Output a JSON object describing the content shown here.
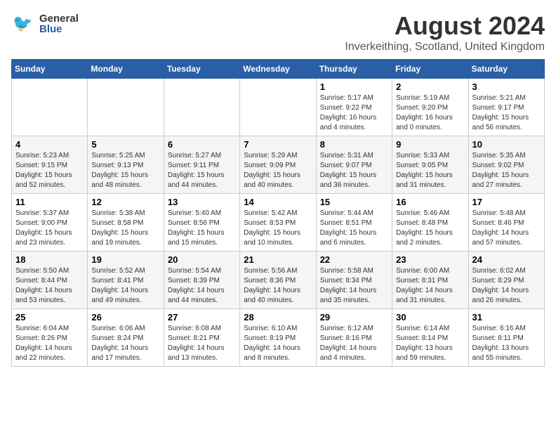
{
  "header": {
    "logo_general": "General",
    "logo_blue": "Blue",
    "month_title": "August 2024",
    "location": "Inverkeithing, Scotland, United Kingdom"
  },
  "calendar": {
    "days_of_week": [
      "Sunday",
      "Monday",
      "Tuesday",
      "Wednesday",
      "Thursday",
      "Friday",
      "Saturday"
    ],
    "weeks": [
      [
        {
          "day": "",
          "info": ""
        },
        {
          "day": "",
          "info": ""
        },
        {
          "day": "",
          "info": ""
        },
        {
          "day": "",
          "info": ""
        },
        {
          "day": "1",
          "info": "Sunrise: 5:17 AM\nSunset: 9:22 PM\nDaylight: 16 hours\nand 4 minutes."
        },
        {
          "day": "2",
          "info": "Sunrise: 5:19 AM\nSunset: 9:20 PM\nDaylight: 16 hours\nand 0 minutes."
        },
        {
          "day": "3",
          "info": "Sunrise: 5:21 AM\nSunset: 9:17 PM\nDaylight: 15 hours\nand 56 minutes."
        }
      ],
      [
        {
          "day": "4",
          "info": "Sunrise: 5:23 AM\nSunset: 9:15 PM\nDaylight: 15 hours\nand 52 minutes."
        },
        {
          "day": "5",
          "info": "Sunrise: 5:25 AM\nSunset: 9:13 PM\nDaylight: 15 hours\nand 48 minutes."
        },
        {
          "day": "6",
          "info": "Sunrise: 5:27 AM\nSunset: 9:11 PM\nDaylight: 15 hours\nand 44 minutes."
        },
        {
          "day": "7",
          "info": "Sunrise: 5:29 AM\nSunset: 9:09 PM\nDaylight: 15 hours\nand 40 minutes."
        },
        {
          "day": "8",
          "info": "Sunrise: 5:31 AM\nSunset: 9:07 PM\nDaylight: 15 hours\nand 36 minutes."
        },
        {
          "day": "9",
          "info": "Sunrise: 5:33 AM\nSunset: 9:05 PM\nDaylight: 15 hours\nand 31 minutes."
        },
        {
          "day": "10",
          "info": "Sunrise: 5:35 AM\nSunset: 9:02 PM\nDaylight: 15 hours\nand 27 minutes."
        }
      ],
      [
        {
          "day": "11",
          "info": "Sunrise: 5:37 AM\nSunset: 9:00 PM\nDaylight: 15 hours\nand 23 minutes."
        },
        {
          "day": "12",
          "info": "Sunrise: 5:38 AM\nSunset: 8:58 PM\nDaylight: 15 hours\nand 19 minutes."
        },
        {
          "day": "13",
          "info": "Sunrise: 5:40 AM\nSunset: 8:56 PM\nDaylight: 15 hours\nand 15 minutes."
        },
        {
          "day": "14",
          "info": "Sunrise: 5:42 AM\nSunset: 8:53 PM\nDaylight: 15 hours\nand 10 minutes."
        },
        {
          "day": "15",
          "info": "Sunrise: 5:44 AM\nSunset: 8:51 PM\nDaylight: 15 hours\nand 6 minutes."
        },
        {
          "day": "16",
          "info": "Sunrise: 5:46 AM\nSunset: 8:48 PM\nDaylight: 15 hours\nand 2 minutes."
        },
        {
          "day": "17",
          "info": "Sunrise: 5:48 AM\nSunset: 8:46 PM\nDaylight: 14 hours\nand 57 minutes."
        }
      ],
      [
        {
          "day": "18",
          "info": "Sunrise: 5:50 AM\nSunset: 8:44 PM\nDaylight: 14 hours\nand 53 minutes."
        },
        {
          "day": "19",
          "info": "Sunrise: 5:52 AM\nSunset: 8:41 PM\nDaylight: 14 hours\nand 49 minutes."
        },
        {
          "day": "20",
          "info": "Sunrise: 5:54 AM\nSunset: 8:39 PM\nDaylight: 14 hours\nand 44 minutes."
        },
        {
          "day": "21",
          "info": "Sunrise: 5:56 AM\nSunset: 8:36 PM\nDaylight: 14 hours\nand 40 minutes."
        },
        {
          "day": "22",
          "info": "Sunrise: 5:58 AM\nSunset: 8:34 PM\nDaylight: 14 hours\nand 35 minutes."
        },
        {
          "day": "23",
          "info": "Sunrise: 6:00 AM\nSunset: 8:31 PM\nDaylight: 14 hours\nand 31 minutes."
        },
        {
          "day": "24",
          "info": "Sunrise: 6:02 AM\nSunset: 8:29 PM\nDaylight: 14 hours\nand 26 minutes."
        }
      ],
      [
        {
          "day": "25",
          "info": "Sunrise: 6:04 AM\nSunset: 8:26 PM\nDaylight: 14 hours\nand 22 minutes."
        },
        {
          "day": "26",
          "info": "Sunrise: 6:06 AM\nSunset: 8:24 PM\nDaylight: 14 hours\nand 17 minutes."
        },
        {
          "day": "27",
          "info": "Sunrise: 6:08 AM\nSunset: 8:21 PM\nDaylight: 14 hours\nand 13 minutes."
        },
        {
          "day": "28",
          "info": "Sunrise: 6:10 AM\nSunset: 8:19 PM\nDaylight: 14 hours\nand 8 minutes."
        },
        {
          "day": "29",
          "info": "Sunrise: 6:12 AM\nSunset: 8:16 PM\nDaylight: 14 hours\nand 4 minutes."
        },
        {
          "day": "30",
          "info": "Sunrise: 6:14 AM\nSunset: 8:14 PM\nDaylight: 13 hours\nand 59 minutes."
        },
        {
          "day": "31",
          "info": "Sunrise: 6:16 AM\nSunset: 8:11 PM\nDaylight: 13 hours\nand 55 minutes."
        }
      ]
    ]
  }
}
